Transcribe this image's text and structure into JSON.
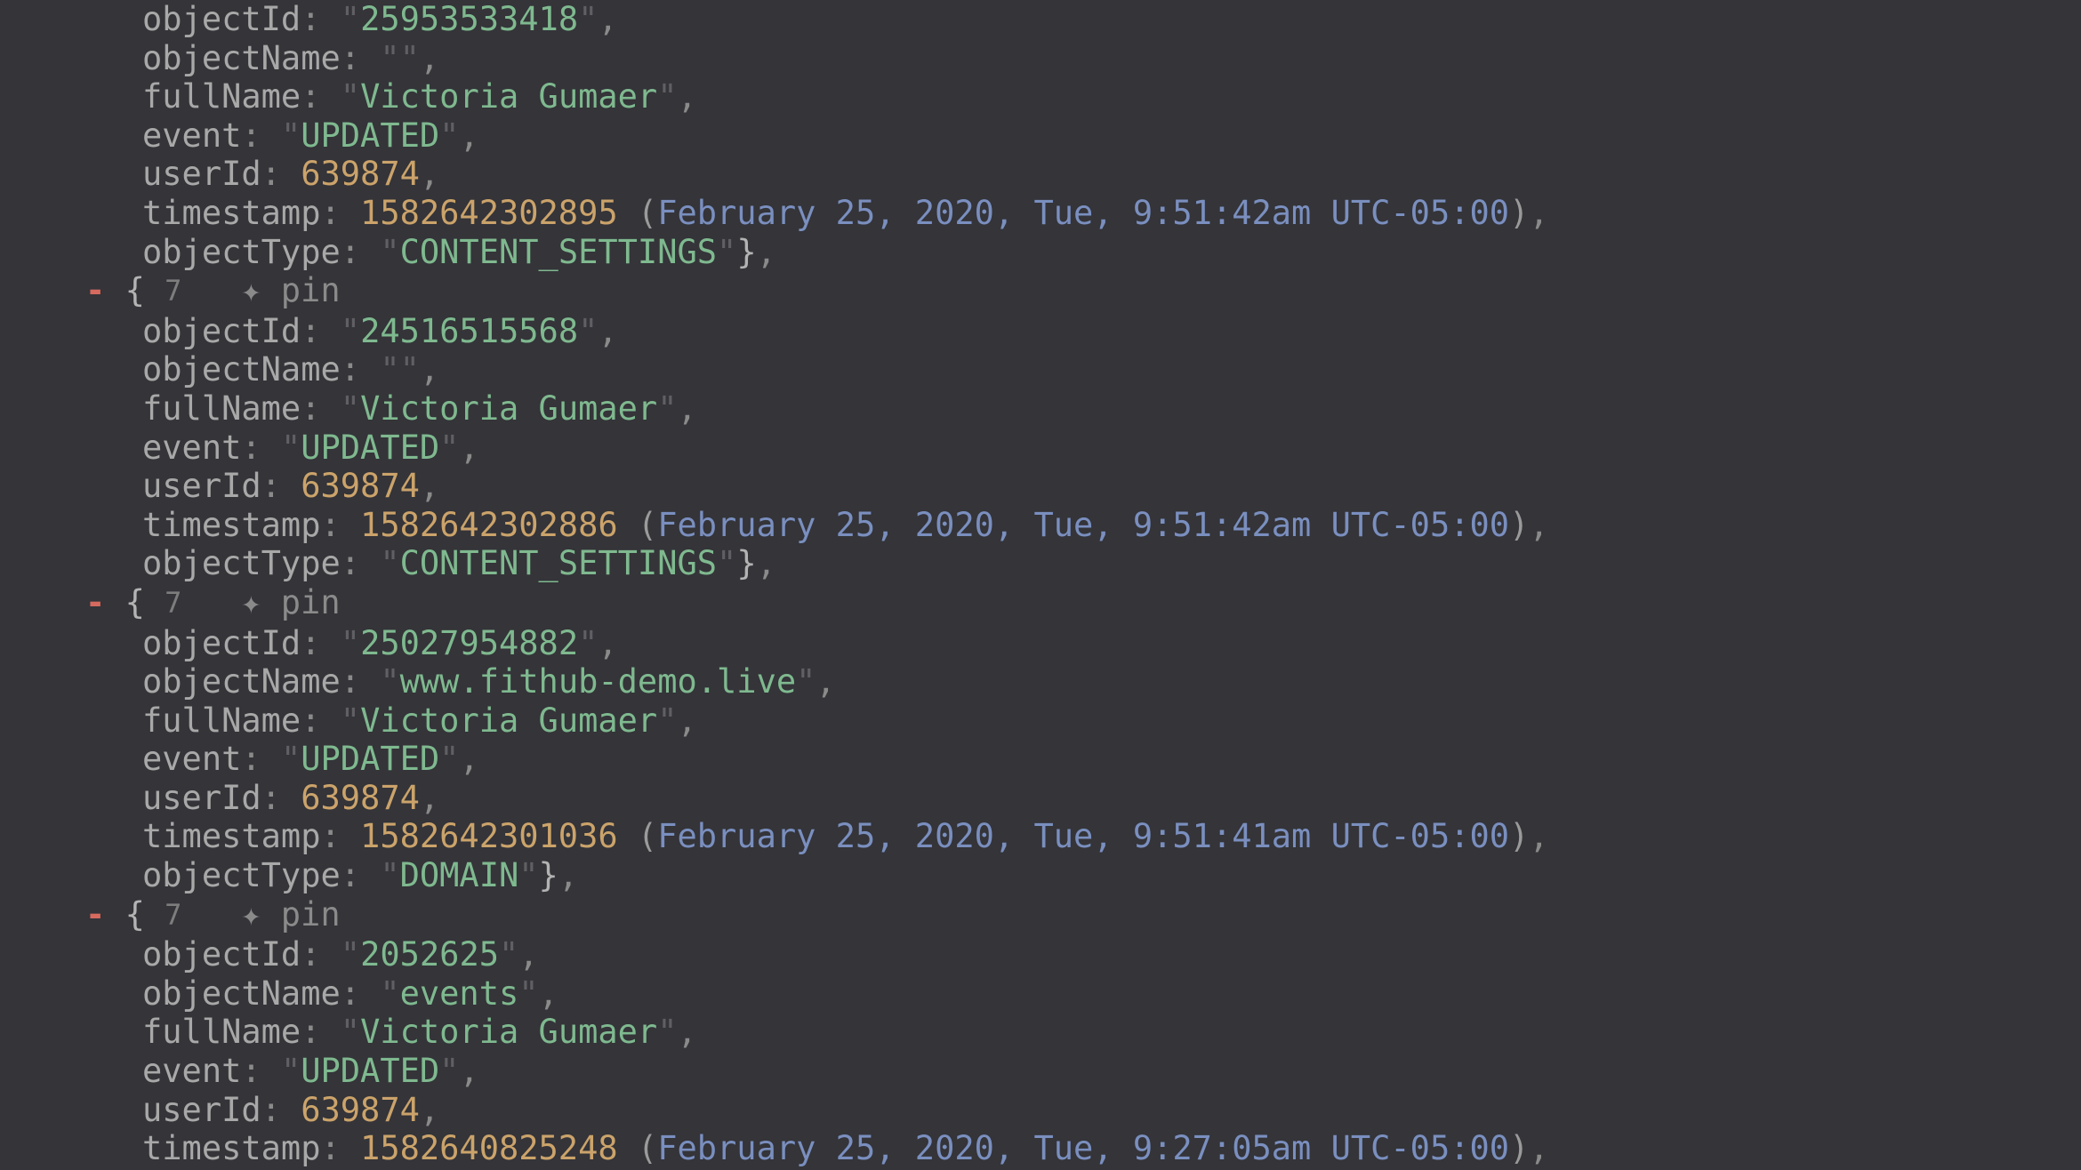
{
  "labels": {
    "objectId": "objectId",
    "objectName": "objectName",
    "fullName": "fullName",
    "event": "event",
    "userId": "userId",
    "timestamp": "timestamp",
    "objectType": "objectType",
    "pin": "pin",
    "count": "7"
  },
  "entries": [
    {
      "showOpener": false,
      "objectId": "25953533418",
      "objectName": "",
      "fullName": "Victoria Gumaer",
      "event": "UPDATED",
      "userId": "639874",
      "timestamp": "1582642302895",
      "timestampHuman": "February 25, 2020, Tue, 9:51:42am UTC-05:00",
      "objectType": "CONTENT_SETTINGS",
      "lastLine": "objectType"
    },
    {
      "showOpener": true,
      "objectId": "24516515568",
      "objectName": "",
      "fullName": "Victoria Gumaer",
      "event": "UPDATED",
      "userId": "639874",
      "timestamp": "1582642302886",
      "timestampHuman": "February 25, 2020, Tue, 9:51:42am UTC-05:00",
      "objectType": "CONTENT_SETTINGS",
      "lastLine": "objectType"
    },
    {
      "showOpener": true,
      "objectId": "25027954882",
      "objectName": "www.fithub-demo.live",
      "fullName": "Victoria Gumaer",
      "event": "UPDATED",
      "userId": "639874",
      "timestamp": "1582642301036",
      "timestampHuman": "February 25, 2020, Tue, 9:51:41am UTC-05:00",
      "objectType": "DOMAIN",
      "lastLine": "objectType"
    },
    {
      "showOpener": true,
      "objectId": "2052625",
      "objectName": "events",
      "fullName": "Victoria Gumaer",
      "event": "UPDATED",
      "userId": "639874",
      "timestamp": "1582640825248",
      "timestampHuman": "February 25, 2020, Tue, 9:27:05am UTC-05:00",
      "objectType": null,
      "lastLine": "timestamp"
    }
  ]
}
